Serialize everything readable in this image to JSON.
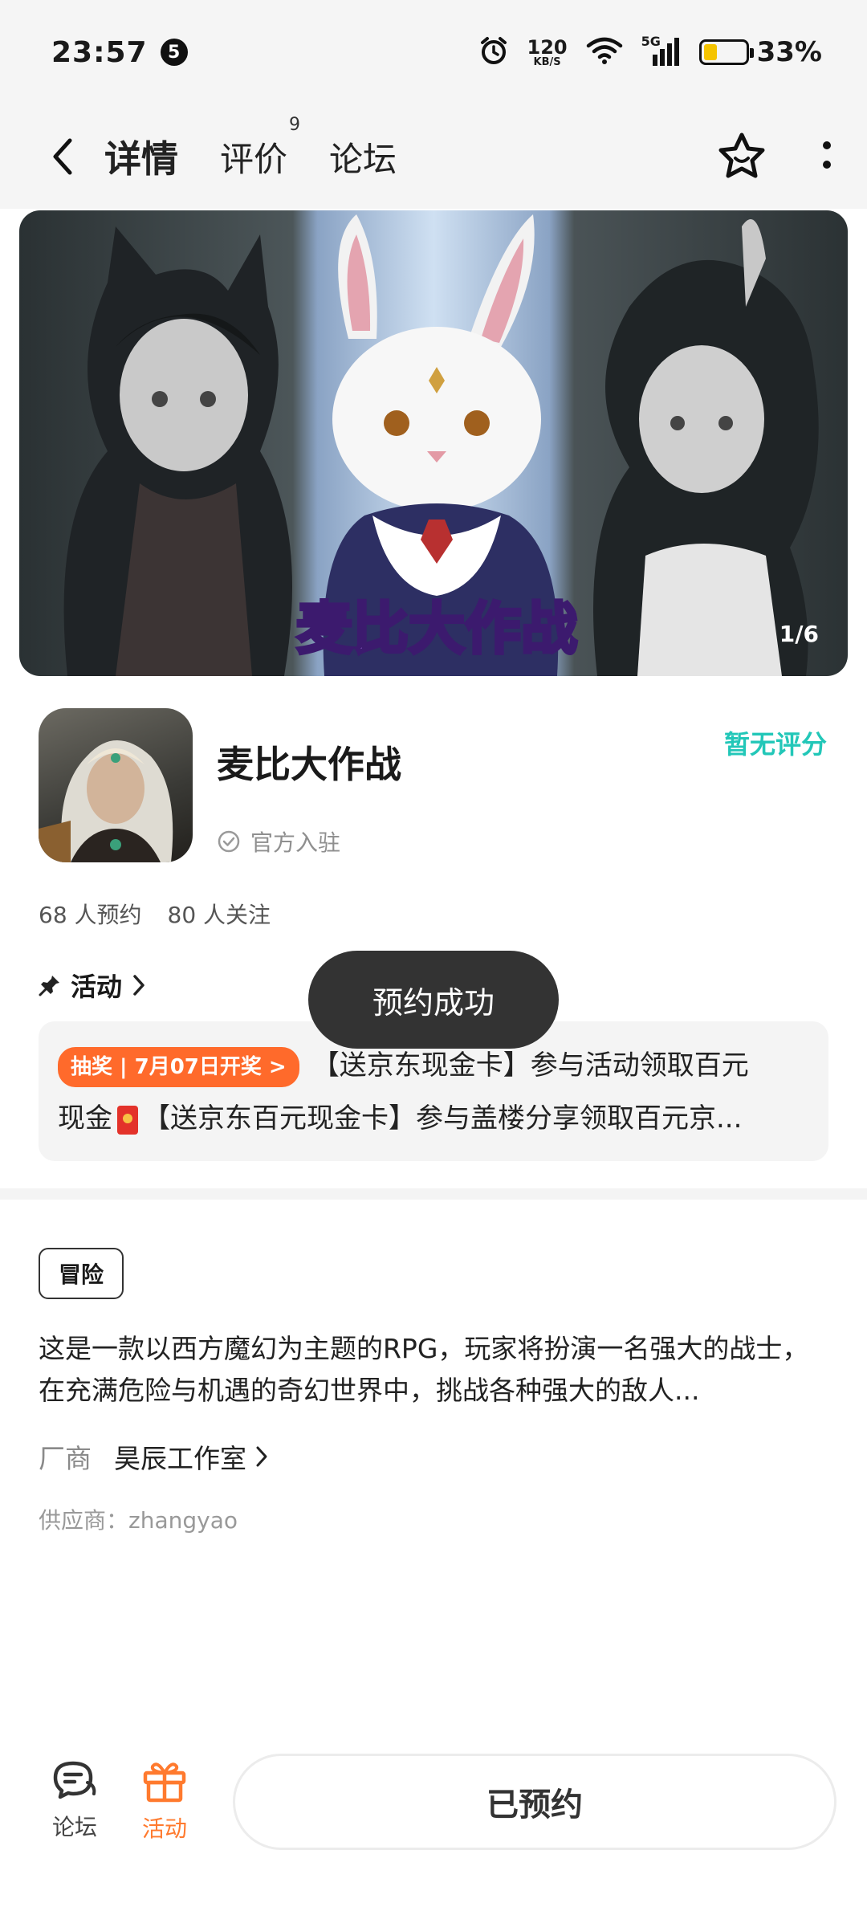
{
  "status_bar": {
    "time": "23:57",
    "notification_count": "5",
    "net_speed_value": "120",
    "net_speed_unit": "KB/S",
    "signal_label": "5G",
    "battery_percent_text": "33%",
    "battery_level": 0.33,
    "battery_color": "#f5c400"
  },
  "nav": {
    "tabs": [
      {
        "label": "详情",
        "active": true
      },
      {
        "label": "评价",
        "badge": "9"
      },
      {
        "label": "论坛"
      }
    ],
    "accent_color": "#2ed3c6"
  },
  "banner": {
    "counter": "1/6",
    "logo_text": "麦比大作战"
  },
  "app": {
    "name": "麦比大作战",
    "official_label": "官方入驻",
    "rating_label": "暂无评分",
    "rating_color": "#22c7b8",
    "reservations": "68 人预约",
    "followers": "80 人关注"
  },
  "activity": {
    "header": "活动",
    "tag": "抽奖 | 7月07日开奖 >",
    "line1": "【送京东现金卡】参与活动领取百元",
    "line2_prefix": "现金",
    "line2_suffix": "【送京东百元现金卡】参与盖楼分享领取百元京..."
  },
  "toast": "预约成功",
  "genre": "冒险",
  "description": "这是一款以西方魔幻为主题的RPG，玩家将扮演一名强大的战士，在充满危险与机遇的奇幻世界中，挑战各种强大的敌人...",
  "vendor": {
    "label": "厂商",
    "name": "昊辰工作室"
  },
  "supplier": "供应商：zhangyao",
  "bottom_bar": {
    "forum_label": "论坛",
    "activity_label": "活动",
    "reserve_button": "已预约",
    "activity_color": "#ff7a2e"
  }
}
